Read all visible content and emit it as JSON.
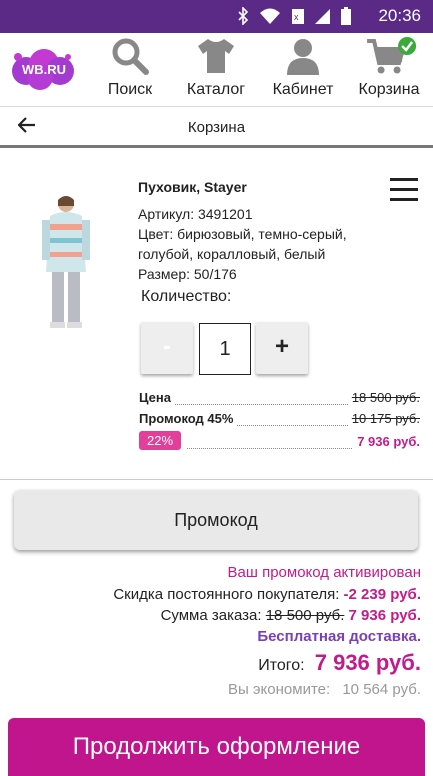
{
  "status": {
    "time": "20:36"
  },
  "nav": {
    "logo": "WB.RU",
    "items": [
      {
        "label": "Поиск",
        "icon": "search-icon"
      },
      {
        "label": "Каталог",
        "icon": "tshirt-icon"
      },
      {
        "label": "Кабинет",
        "icon": "user-icon"
      },
      {
        "label": "Корзина",
        "icon": "cart-icon"
      }
    ]
  },
  "subheader": {
    "title": "Корзина"
  },
  "product": {
    "name": "Пуховик, Stayer",
    "article": "Артикул: 3491201",
    "color": "Цвет: бирюзовый, темно-серый, голубой, коралловый, белый",
    "size": "Размер: 50/176",
    "quantity_label": "Количество:",
    "minus": "-",
    "quantity": "1",
    "plus": "+",
    "price_label": "Цена",
    "price_old": "18 500 руб.",
    "promo_label": "Промокод 45%",
    "promo_old": "10 175 руб.",
    "discount_badge": "22%",
    "price_final": "7 936 руб."
  },
  "promo_button": "Промокод",
  "summary": {
    "activated": "Ваш промокод активирован",
    "loyalty_label": "Скидка постоянного покупателя:",
    "loyalty_value": "-2 239 руб.",
    "order_label": "Сумма заказа:",
    "order_old": "18 500 руб.",
    "order_new": "7 936 руб.",
    "delivery": "Бесплатная доставка.",
    "total_label": "Итого:",
    "total_value": "7 936 руб.",
    "save_label": "Вы экономите:",
    "save_value": "10 564 руб."
  },
  "cta": "Продолжить оформление",
  "colors": {
    "accent": "#c21b8c",
    "statusbar": "#5b2a86",
    "logo": "#a43bd0"
  }
}
